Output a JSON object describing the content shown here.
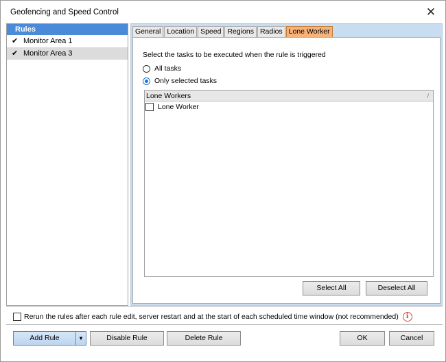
{
  "window": {
    "title": "Geofencing and Speed Control"
  },
  "rules": {
    "header": "Rules",
    "items": [
      {
        "label": "Monitor Area 1",
        "checked": true,
        "selected": false
      },
      {
        "label": "Monitor Area 3",
        "checked": true,
        "selected": true
      }
    ]
  },
  "tabs": [
    {
      "label": "General"
    },
    {
      "label": "Location"
    },
    {
      "label": "Speed"
    },
    {
      "label": "Regions"
    },
    {
      "label": "Radios"
    },
    {
      "label": "Lone Worker",
      "active": true
    }
  ],
  "lone_worker": {
    "instruction": "Select the tasks to be executed when the rule is triggered",
    "option_all": "All tasks",
    "option_selected": "Only selected tasks",
    "selected_option": "Only selected tasks",
    "list_header": "Lone Workers",
    "sort_glyph": "/",
    "rows": [
      {
        "label": "Lone Worker",
        "checked": false
      }
    ],
    "select_all": "Select All",
    "deselect_all": "Deselect All"
  },
  "footer": {
    "rerun_label": "Rerun the rules after each rule edit, server restart and at the start of each scheduled time window (not recommended)",
    "rerun_checked": false,
    "info_glyph": "i",
    "add_rule": "Add Rule",
    "dropdown_glyph": "▼",
    "disable_rule": "Disable Rule",
    "delete_rule": "Delete Rule",
    "ok": "OK",
    "cancel": "Cancel"
  },
  "close_glyph": "✕",
  "check_glyph": "✔",
  "colors": {
    "rules_header": "#4a8ad8",
    "active_tab": "#f7b27a",
    "tab_area": "#c9ddf1",
    "accent_radio": "#2276d4",
    "info_icon": "#dd4444"
  }
}
